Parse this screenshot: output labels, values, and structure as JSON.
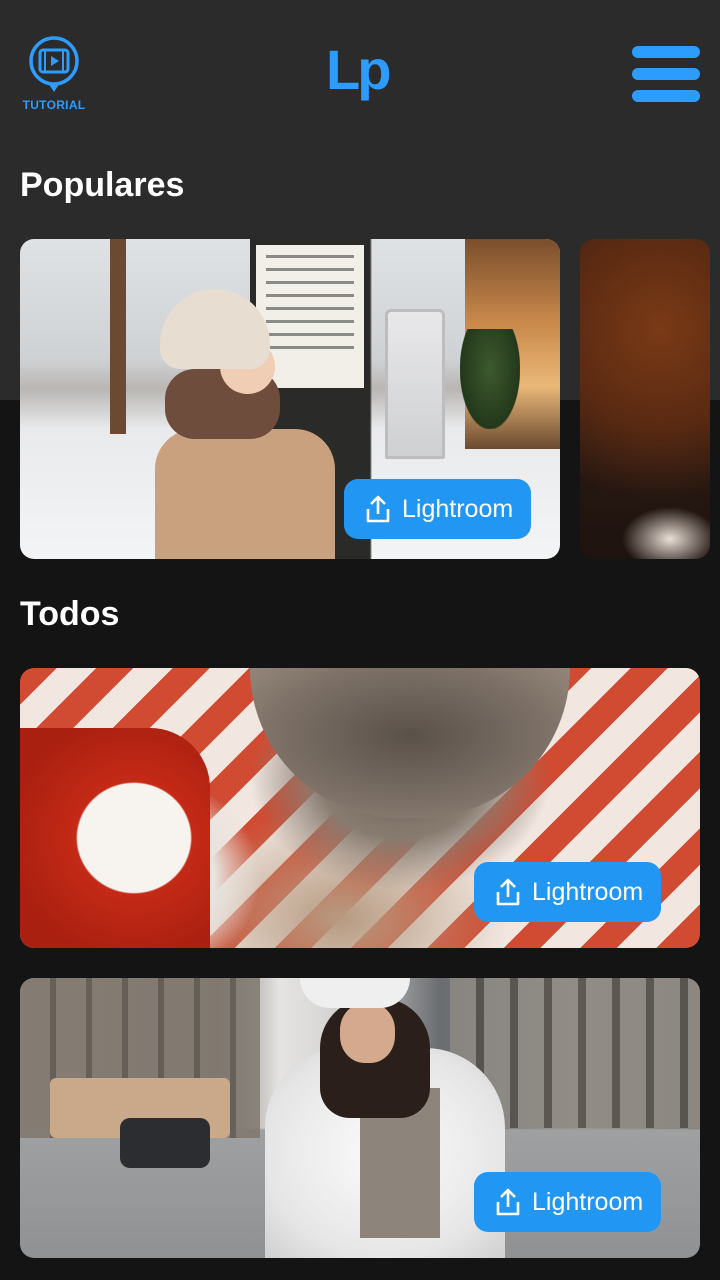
{
  "header": {
    "tutorial_label": "TUTORIAL",
    "tutorial_icon": "video-tutorial-icon",
    "logo": "Lp",
    "menu_icon": "hamburger-menu-icon"
  },
  "sections": {
    "popular_title": "Populares",
    "all_title": "Todos"
  },
  "cards": {
    "popular": [
      {
        "button_label": "Lightroom"
      },
      {
        "button_label": ""
      }
    ],
    "all": [
      {
        "button_label": "Lightroom"
      },
      {
        "button_label": "Lightroom"
      }
    ]
  },
  "colors": {
    "accent": "#2d9cff",
    "button": "#2196f3",
    "header_bg": "#2b2b2b",
    "body_bg": "#141414"
  }
}
